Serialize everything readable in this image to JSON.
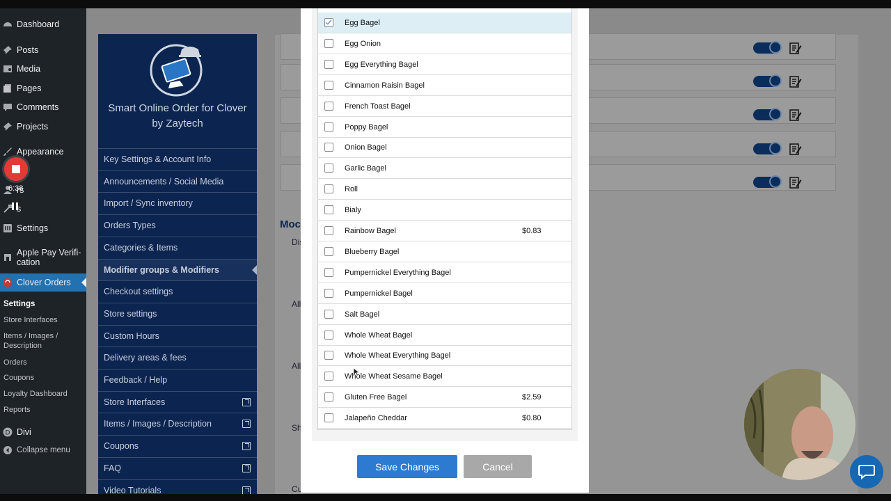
{
  "wp_menu": {
    "items": [
      {
        "icon": "dashboard-icon",
        "label": "Dashboard"
      },
      {
        "icon": "pin-icon",
        "label": "Posts"
      },
      {
        "icon": "media-icon",
        "label": "Media"
      },
      {
        "icon": "page-icon",
        "label": "Pages"
      },
      {
        "icon": "comment-icon",
        "label": "Comments"
      },
      {
        "icon": "pin-icon",
        "label": "Projects"
      },
      {
        "icon": "brush-icon",
        "label": "Appearance"
      },
      {
        "icon": "plugin-icon",
        "label": "ins"
      },
      {
        "icon": "user-icon",
        "label": "rs"
      },
      {
        "icon": "tool-icon",
        "label": "s"
      },
      {
        "icon": "settings-icon",
        "label": "Settings"
      },
      {
        "icon": "apple-icon",
        "label": "Apple Pay Verifi-\ncation"
      },
      {
        "icon": "clover-icon",
        "label": "Clover Orders"
      }
    ],
    "submenu": [
      "Settings",
      "Store Interfaces",
      "Items / Images /\nDescription",
      "Orders",
      "Coupons",
      "Loyalty Dashboard",
      "Reports"
    ],
    "divi": "Divi",
    "collapse": "Collapse menu"
  },
  "recorder": {
    "time": "6:38"
  },
  "plugin": {
    "title_line1": "Smart Online Order for Clover",
    "title_line2": "by Zaytech",
    "nav": [
      {
        "label": "Key Settings & Account Info",
        "ext": false
      },
      {
        "label": "Announcements / Social Media",
        "ext": false
      },
      {
        "label": "Import / Sync inventory",
        "ext": false
      },
      {
        "label": "Orders Types",
        "ext": false
      },
      {
        "label": "Categories & Items",
        "ext": false
      },
      {
        "label": "Modifier groups & Modifiers",
        "ext": false,
        "active": true
      },
      {
        "label": "Checkout settings",
        "ext": false
      },
      {
        "label": "Store settings",
        "ext": false
      },
      {
        "label": "Custom Hours",
        "ext": false
      },
      {
        "label": "Delivery areas & fees",
        "ext": false
      },
      {
        "label": "Feedback / Help",
        "ext": false
      },
      {
        "label": "Store Interfaces",
        "ext": true
      },
      {
        "label": "Items / Images / Description",
        "ext": true
      },
      {
        "label": "Coupons",
        "ext": true
      },
      {
        "label": "FAQ",
        "ext": true
      },
      {
        "label": "Video Tutorials",
        "ext": true
      }
    ]
  },
  "background": {
    "section_title": "Moc",
    "fragments": [
      "Dis",
      "All",
      "All",
      "Sh",
      "Cu"
    ]
  },
  "modal": {
    "options": [
      {
        "name": "Egg Bagel",
        "price": "",
        "checked": true
      },
      {
        "name": "Egg Onion",
        "price": "",
        "checked": false
      },
      {
        "name": "Egg Everything Bagel",
        "price": "",
        "checked": false
      },
      {
        "name": "Cinnamon Raisin Bagel",
        "price": "",
        "checked": false
      },
      {
        "name": "French Toast Bagel",
        "price": "",
        "checked": false
      },
      {
        "name": "Poppy Bagel",
        "price": "",
        "checked": false
      },
      {
        "name": "Onion Bagel",
        "price": "",
        "checked": false
      },
      {
        "name": "Garlic Bagel",
        "price": "",
        "checked": false
      },
      {
        "name": "Roll",
        "price": "",
        "checked": false
      },
      {
        "name": "Bialy",
        "price": "",
        "checked": false
      },
      {
        "name": "Rainbow Bagel",
        "price": "$0.83",
        "checked": false
      },
      {
        "name": "Blueberry Bagel",
        "price": "",
        "checked": false
      },
      {
        "name": "Pumpernickel Everything Bagel",
        "price": "",
        "checked": false
      },
      {
        "name": "Pumpernickel Bagel",
        "price": "",
        "checked": false
      },
      {
        "name": "Salt Bagel",
        "price": "",
        "checked": false
      },
      {
        "name": "Whole Wheat Bagel",
        "price": "",
        "checked": false
      },
      {
        "name": "Whole Wheat Everything Bagel",
        "price": "",
        "checked": false
      },
      {
        "name": "Whole Wheat Sesame Bagel",
        "price": "",
        "checked": false
      },
      {
        "name": "Gluten Free Bagel",
        "price": "$2.59",
        "checked": false
      },
      {
        "name": "Jalapeño Cheddar",
        "price": "$0.80",
        "checked": false
      }
    ],
    "save_label": "Save Changes",
    "cancel_label": "Cancel"
  },
  "colors": {
    "wp_sidebar": "#1d2327",
    "wp_active": "#2271b1",
    "plugin_nav": "#0c2550",
    "save_button": "#2c7bd1",
    "cancel_button": "#a8a8a8",
    "checked_row": "#ddeef5"
  }
}
